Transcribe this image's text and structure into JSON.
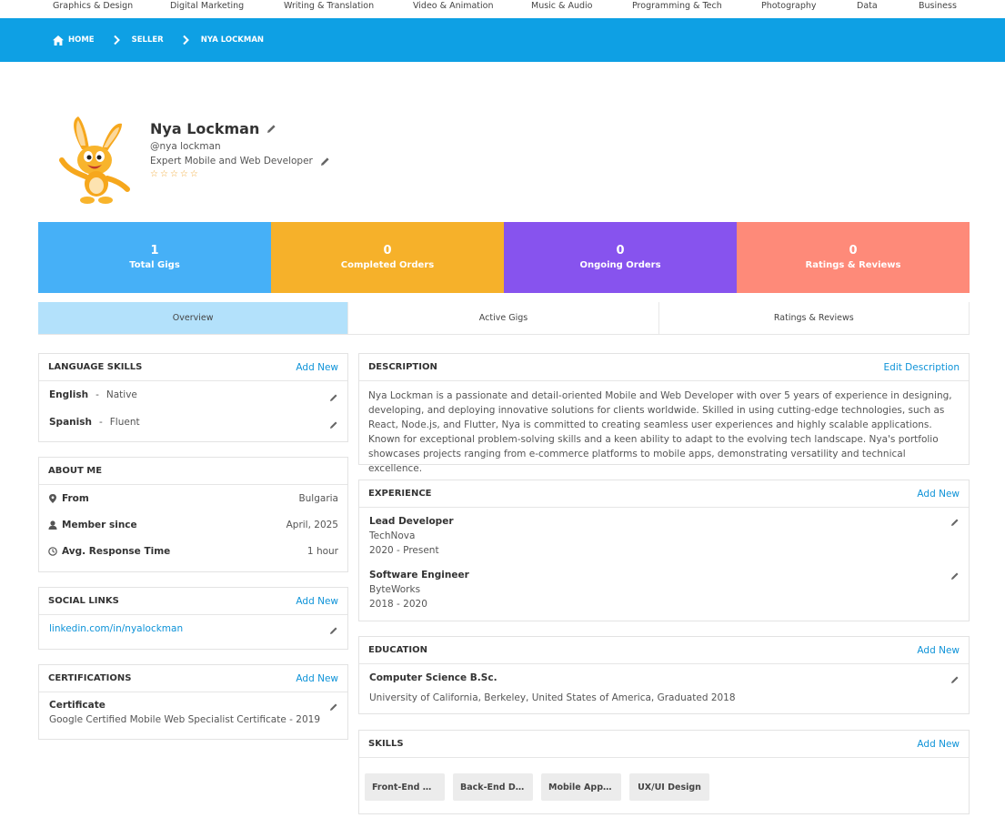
{
  "categories": [
    "Graphics & Design",
    "Digital Marketing",
    "Writing & Translation",
    "Video & Animation",
    "Music & Audio",
    "Programming & Tech",
    "Photography",
    "Data",
    "Business"
  ],
  "breadcrumb": [
    "HOME",
    "SELLER",
    "NYA LOCKMAN"
  ],
  "profile": {
    "name": "Nya Lockman",
    "username": "@nya lockman",
    "tagline": "Expert Mobile and Web Developer",
    "stars": [
      "☆",
      "☆",
      "☆",
      "☆",
      "☆"
    ]
  },
  "stats": [
    {
      "value": "1",
      "label": "Total Gigs",
      "color": "#46b0f7"
    },
    {
      "value": "0",
      "label": "Completed Orders",
      "color": "#f6b12a"
    },
    {
      "value": "0",
      "label": "Ongoing Orders",
      "color": "#8753ee"
    },
    {
      "value": "0",
      "label": "Ratings & Reviews",
      "color": "#fe8a79"
    }
  ],
  "tabs": [
    "Overview",
    "Active Gigs",
    "Ratings & Reviews"
  ],
  "language": {
    "title": "LANGUAGE SKILLS",
    "action": "Add New",
    "items": [
      {
        "name": "English",
        "sep": "-",
        "level": "Native"
      },
      {
        "name": "Spanish",
        "sep": "-",
        "level": "Fluent"
      }
    ]
  },
  "about": {
    "title": "ABOUT ME",
    "rows": [
      {
        "label": "From",
        "value": "Bulgaria",
        "icon": "map-marker-icon"
      },
      {
        "label": "Member since",
        "value": "April, 2025",
        "icon": "user-icon"
      },
      {
        "label": "Avg. Response Time",
        "value": "1 hour",
        "icon": "clock-icon"
      }
    ]
  },
  "social": {
    "title": "SOCIAL LINKS",
    "action": "Add New",
    "links": [
      "linkedin.com/in/nyalockman"
    ]
  },
  "certifications": {
    "title": "CERTIFICATIONS",
    "action": "Add New",
    "items": [
      {
        "title": "Certificate",
        "detail": "Google Certified Mobile Web Specialist Certificate - 2019"
      }
    ]
  },
  "description": {
    "title": "DESCRIPTION",
    "action": "Edit Description",
    "text": "Nya Lockman is a passionate and detail-oriented Mobile and Web Developer with over 5 years of experience in designing, developing, and deploying innovative solutions for clients worldwide. Skilled in using cutting-edge technologies, such as React, Node.js, and Flutter, Nya is committed to creating seamless user experiences and highly scalable applications. Known for exceptional problem-solving skills and a keen ability to adapt to the evolving tech landscape. Nya's portfolio showcases projects ranging from e-commerce platforms to mobile apps, demonstrating versatility and technical excellence."
  },
  "experience": {
    "title": "EXPERIENCE",
    "action": "Add New",
    "items": [
      {
        "role": "Lead Developer",
        "company": "TechNova",
        "period": "2020 - Present"
      },
      {
        "role": "Software Engineer",
        "company": "ByteWorks",
        "period": "2018 - 2020"
      }
    ]
  },
  "education": {
    "title": "EDUCATION",
    "action": "Add New",
    "items": [
      {
        "degree": "Computer Science B.Sc.",
        "detail": "University of California, Berkeley, United States of America, Graduated 2018"
      }
    ]
  },
  "skills": {
    "title": "SKILLS",
    "action": "Add New",
    "items": [
      "Front-End Development",
      "Back-End Development",
      "Mobile App Development",
      "UX/UI Design"
    ]
  },
  "colors": {
    "brand_blue": "#0ea0e4",
    "link_blue": "#0e93d8",
    "active_tab": "#b3e1fb"
  }
}
